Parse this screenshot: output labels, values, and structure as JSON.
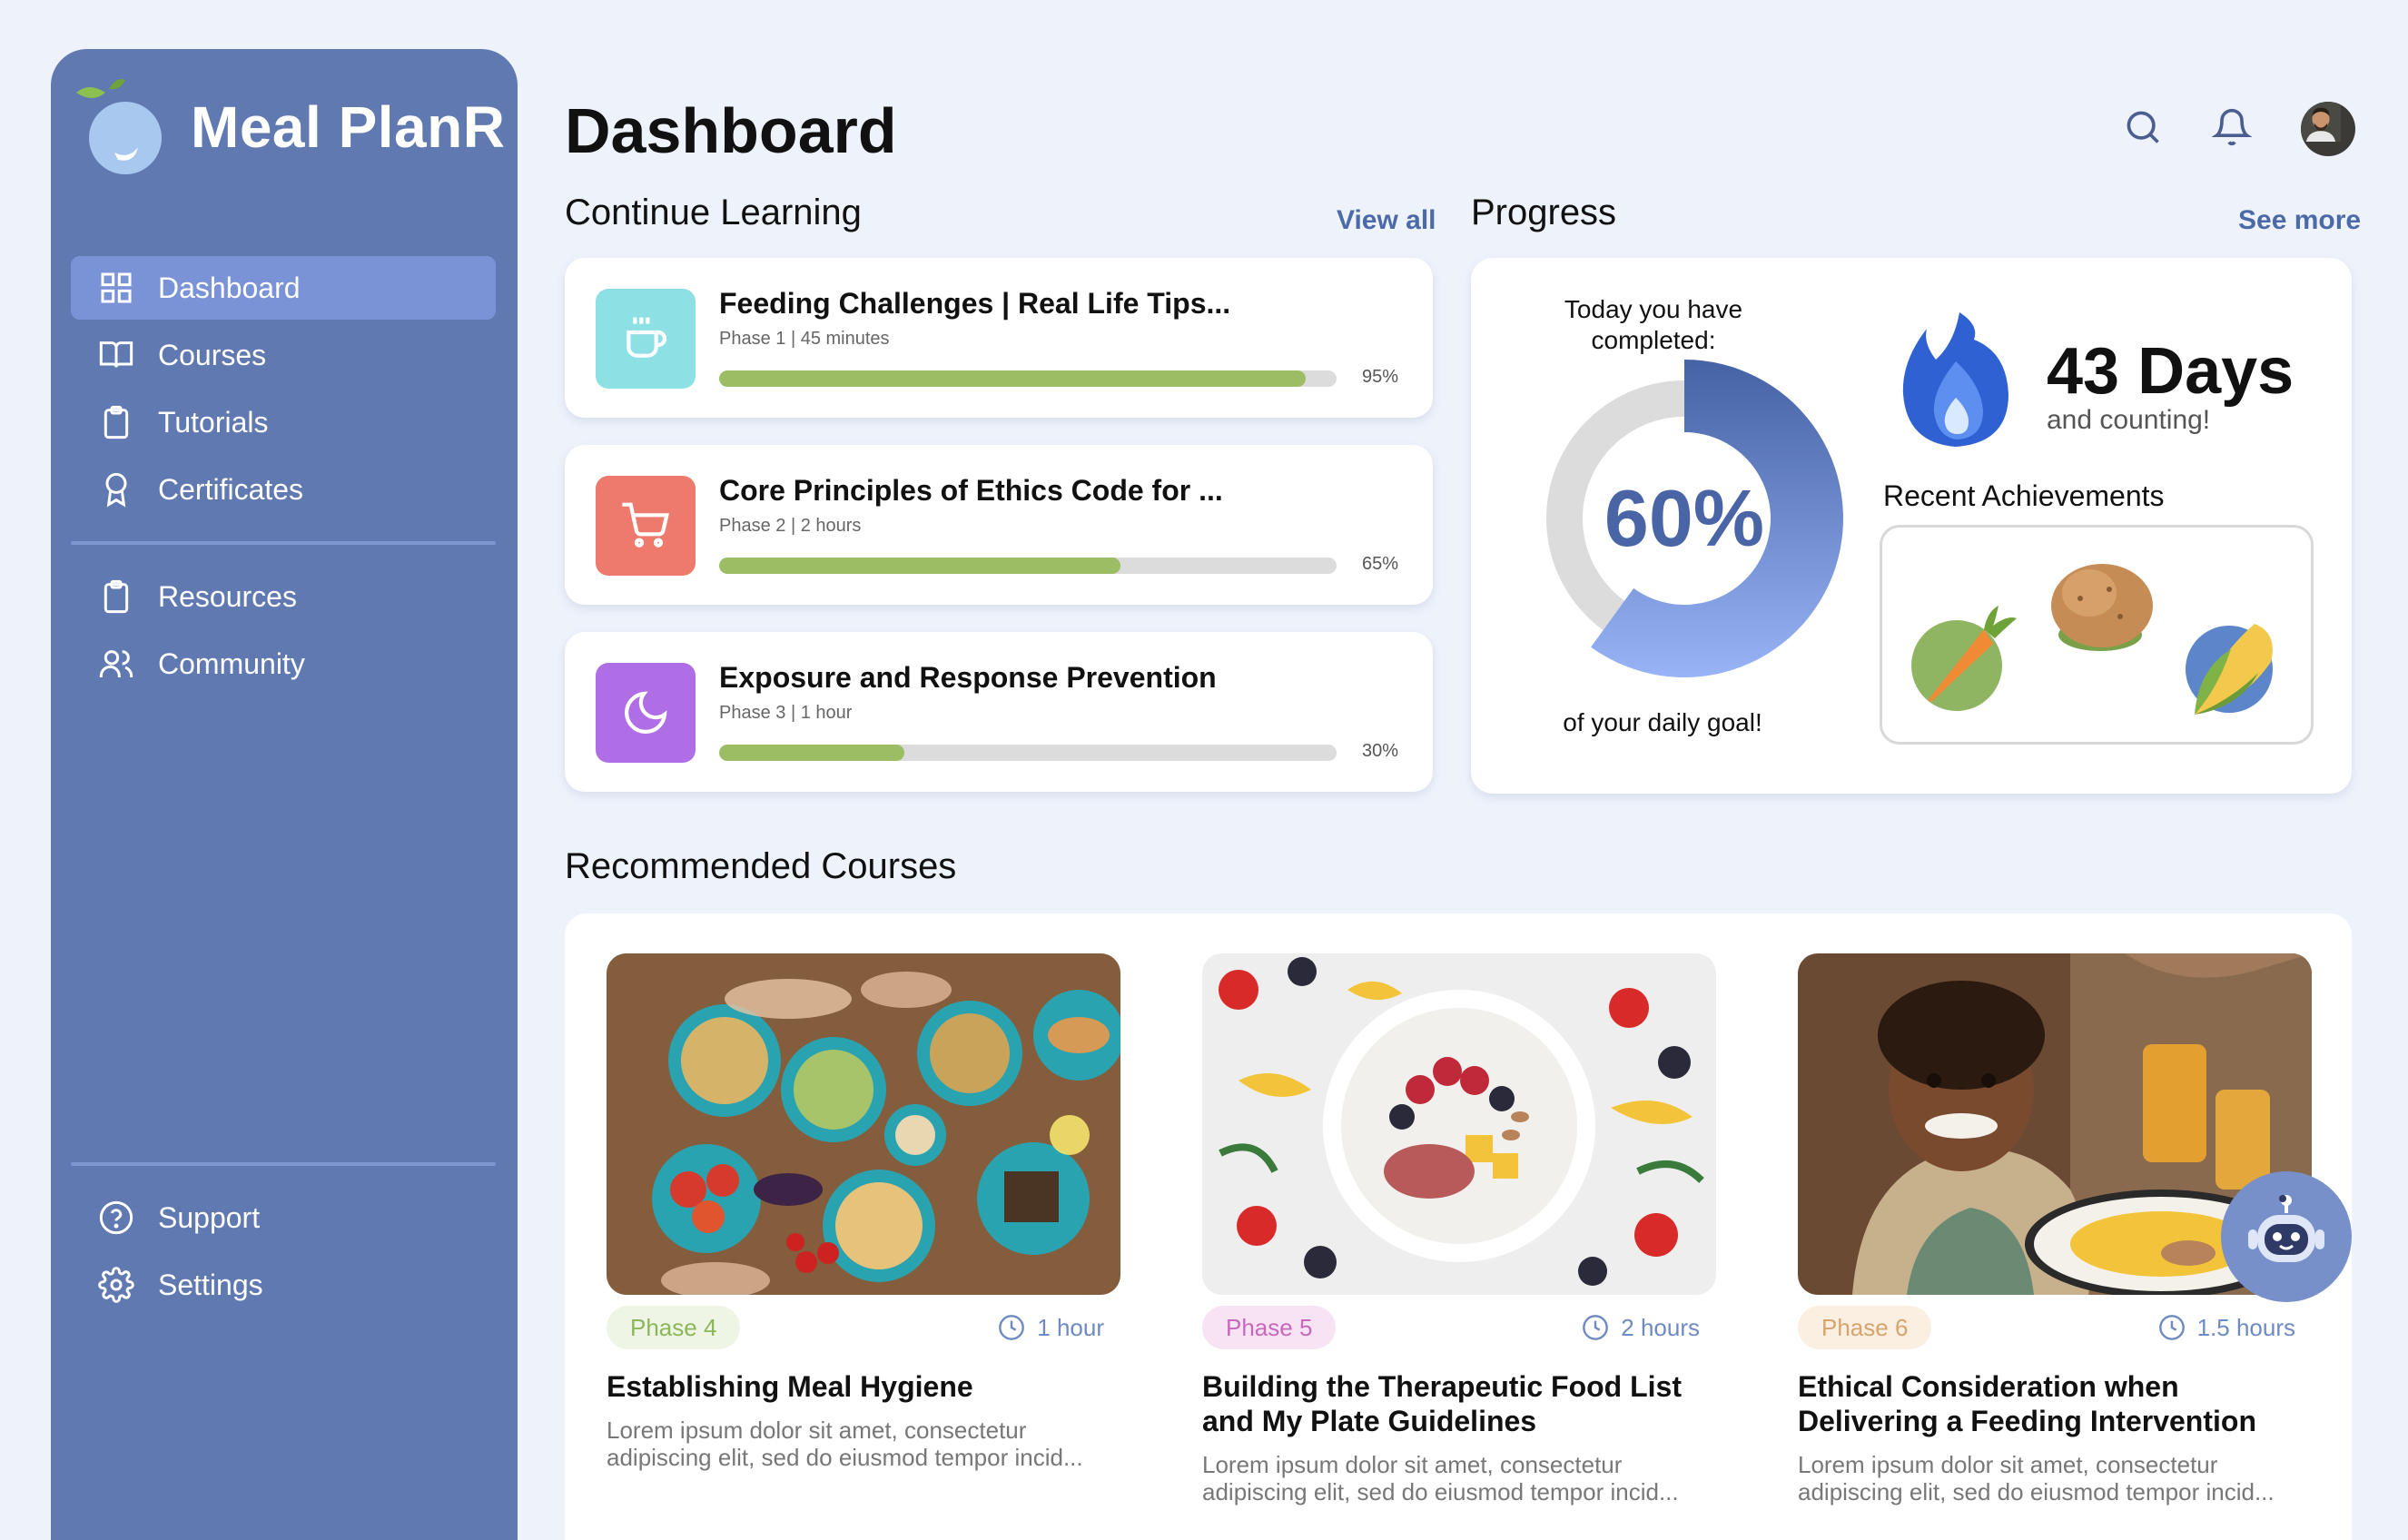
{
  "app": {
    "name": "Meal PlanR",
    "page_title": "Dashboard"
  },
  "sidebar": {
    "items": [
      {
        "label": "Dashboard",
        "icon": "grid-icon",
        "active": true
      },
      {
        "label": "Courses",
        "icon": "book-icon"
      },
      {
        "label": "Tutorials",
        "icon": "clipboard-icon"
      },
      {
        "label": "Certificates",
        "icon": "award-icon"
      }
    ],
    "items2": [
      {
        "label": "Resources",
        "icon": "clipboard-icon"
      },
      {
        "label": "Community",
        "icon": "users-icon"
      }
    ],
    "bottom": [
      {
        "label": "Support",
        "icon": "help-icon"
      },
      {
        "label": "Settings",
        "icon": "gear-icon"
      }
    ]
  },
  "continue_learning": {
    "title": "Continue Learning",
    "link": "View all",
    "courses": [
      {
        "title": "Feeding Challenges | Real Life Tips...",
        "meta": "Phase 1 | 45 minutes",
        "progress": 95,
        "progress_label": "95%",
        "color": "#8de0e3",
        "icon": "cup-icon"
      },
      {
        "title": "Core Principles of Ethics Code for ...",
        "meta": "Phase 2 | 2 hours",
        "progress": 65,
        "progress_label": "65%",
        "color": "#ee7a6d",
        "icon": "cart-icon"
      },
      {
        "title": "Exposure and Response Prevention",
        "meta": "Phase 3 |  1 hour",
        "progress": 30,
        "progress_label": "30%",
        "color": "#b06ee6",
        "icon": "moon-icon"
      }
    ]
  },
  "progress": {
    "title": "Progress",
    "link": "See more",
    "today_text": "Today you have completed:",
    "percent_label": "60%",
    "percent": 60,
    "goal_text": "of your daily goal!",
    "streak_days": "43 Days",
    "streak_sub": "and counting!",
    "achievements_title": "Recent Achievements",
    "achievements": [
      "carrot-icon",
      "potato-icon",
      "corn-icon"
    ]
  },
  "recommended": {
    "title": "Recommended Courses",
    "courses": [
      {
        "phase": "Phase 4",
        "duration": "1 hour",
        "title": "Establishing Meal Hygiene",
        "desc": "Lorem ipsum dolor sit amet, consectetur adipiscing elit, sed do eiusmod tempor incid...",
        "badge_bg": "#eef5e4",
        "badge_fg": "#8cb65a"
      },
      {
        "phase": "Phase 5",
        "duration": "2 hours",
        "title": "Building the Therapeutic Food List and My Plate Guidelines",
        "desc": "Lorem ipsum dolor sit amet, consectetur adipiscing elit, sed do eiusmod tempor incid...",
        "badge_bg": "#f8e3f4",
        "badge_fg": "#c768bb"
      },
      {
        "phase": "Phase 6",
        "duration": "1.5 hours",
        "title": "Ethical Consideration when Delivering a Feeding Intervention",
        "desc": "Lorem ipsum dolor sit amet, consectetur adipiscing elit, sed do eiusmod tempor incid...",
        "badge_bg": "#fbefe2",
        "badge_fg": "#d6a46c"
      }
    ]
  },
  "colors": {
    "sidebar": "#6079b0",
    "accent": "#4965a6",
    "progress_fill": "#9cbd63"
  }
}
